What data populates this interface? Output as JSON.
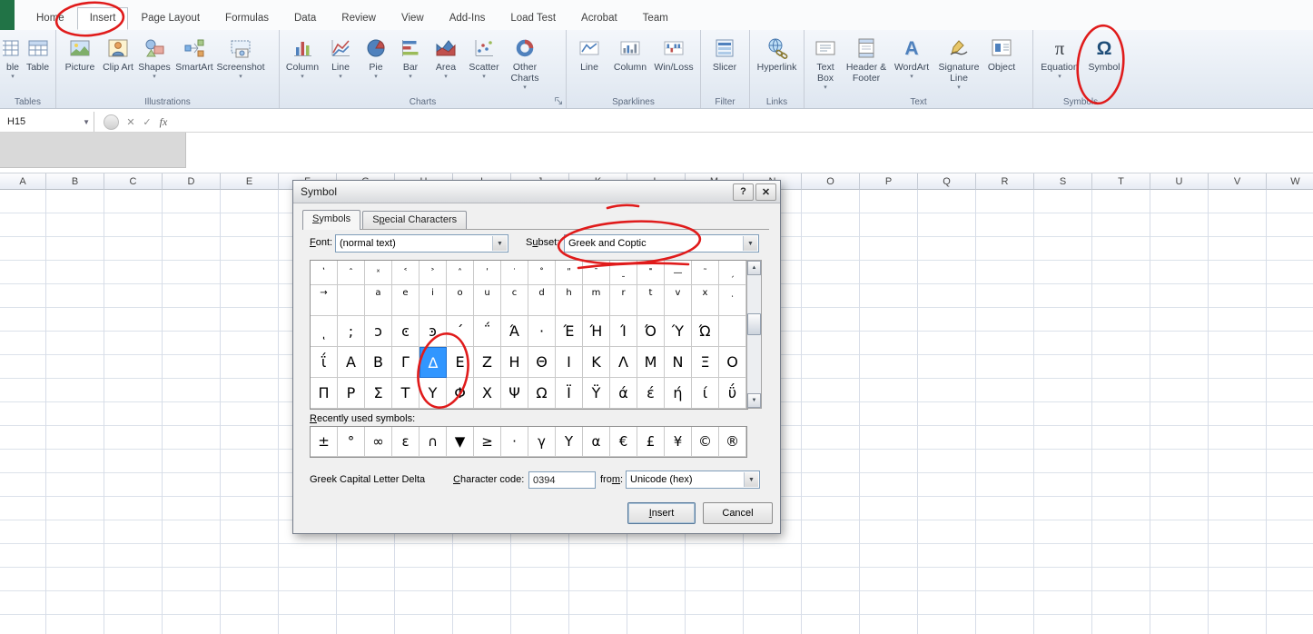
{
  "ribbon": {
    "tabs": [
      {
        "label": "Home"
      },
      {
        "label": "Insert",
        "active": true
      },
      {
        "label": "Page Layout"
      },
      {
        "label": "Formulas"
      },
      {
        "label": "Data"
      },
      {
        "label": "Review"
      },
      {
        "label": "View"
      },
      {
        "label": "Add-Ins"
      },
      {
        "label": "Load Test"
      },
      {
        "label": "Acrobat"
      },
      {
        "label": "Team"
      }
    ],
    "groups": {
      "tables": {
        "label": "Tables",
        "pivottable_cut": "ble",
        "table": "Table"
      },
      "illustrations": {
        "label": "Illustrations",
        "picture": "Picture",
        "clip_art": "Clip Art",
        "shapes": "Shapes",
        "smartart": "SmartArt",
        "screenshot": "Screenshot"
      },
      "charts": {
        "label": "Charts",
        "column": "Column",
        "line": "Line",
        "pie": "Pie",
        "bar": "Bar",
        "area": "Area",
        "scatter": "Scatter",
        "other_charts": "Other Charts"
      },
      "sparklines": {
        "label": "Sparklines",
        "line": "Line",
        "column": "Column",
        "win_loss": "Win/Loss"
      },
      "filter": {
        "label": "Filter",
        "slicer": "Slicer"
      },
      "links": {
        "label": "Links",
        "hyperlink": "Hyperlink"
      },
      "text": {
        "label": "Text",
        "text_box": "Text Box",
        "header_footer": "Header & Footer",
        "wordart": "WordArt",
        "signature_line": "Signature Line",
        "object": "Object"
      },
      "symbols": {
        "label": "Symbols",
        "equation": "Equation",
        "symbol": "Symbol"
      }
    }
  },
  "icons": {
    "equation": "π",
    "symbol": "Ω",
    "wordart": "A"
  },
  "formula_bar": {
    "name_box": "H15",
    "cancel": "✕",
    "enter": "✓",
    "fx": "fx"
  },
  "sheet": {
    "columns": [
      "A",
      "B",
      "C",
      "D",
      "E",
      "F",
      "G",
      "H",
      "I",
      "J",
      "K",
      "L",
      "M",
      "N",
      "O",
      "P",
      "Q",
      "R",
      "S",
      "T",
      "U",
      "V",
      "W"
    ]
  },
  "dialog": {
    "title": "Symbol",
    "help_button": "?",
    "close_button": "✕",
    "tabs": {
      "symbols": "Symbols",
      "special": "Special Characters"
    },
    "font_label": "Font:",
    "font_value": "(normal text)",
    "subset_label": "Subset:",
    "subset_value": "Greek and Coptic",
    "recent_label": "Recently used symbols:",
    "selected_symbol_name": "Greek Capital Letter Delta",
    "charcode_label": "Character code:",
    "charcode_value": "0394",
    "from_label": "from:",
    "from_value": "Unicode (hex)",
    "insert_button": "Insert",
    "cancel_button": "Cancel",
    "grid": {
      "selected_row": 3,
      "selected_col": 4,
      "rows": [
        [
          "ʽ",
          "ˆ",
          "ˣ",
          "˂",
          "˃",
          "˄",
          "ʹ",
          "˙",
          "˚",
          "ʺ",
          "ˉ",
          "ˍ",
          "˭",
          "—",
          "˜",
          "ˏ"
        ],
        [
          "→",
          "",
          "a",
          "e",
          "i",
          "o",
          "u",
          "c",
          "d",
          "h",
          "m",
          "r",
          "t",
          "v",
          "x",
          "ͺ"
        ],
        [
          "ͺ",
          ";",
          "ͻ",
          "ͼ",
          "ͽ",
          "΄",
          "΅",
          "Ά",
          "·",
          "Έ",
          "Ή",
          "Ί",
          "Ό",
          "Ύ",
          "Ώ",
          ""
        ],
        [
          "ΐ",
          "Α",
          "Β",
          "Γ",
          "Δ",
          "Ε",
          "Ζ",
          "Η",
          "Θ",
          "Ι",
          "Κ",
          "Λ",
          "Μ",
          "Ν",
          "Ξ",
          "Ο"
        ],
        [
          "Π",
          "Ρ",
          "Σ",
          "Τ",
          "Υ",
          "Φ",
          "Χ",
          "Ψ",
          "Ω",
          "Ϊ",
          "Ϋ",
          "ά",
          "έ",
          "ή",
          "ί",
          "ΰ"
        ]
      ]
    },
    "recent": [
      "±",
      "°",
      "∞",
      "ε",
      "∩",
      "▼",
      "≥",
      "·",
      "γ",
      "Υ",
      "α",
      "€",
      "£",
      "¥",
      "©",
      "®"
    ]
  },
  "annotations": {
    "color": "#e01b1b"
  }
}
